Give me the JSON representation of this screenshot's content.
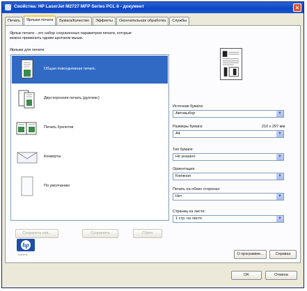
{
  "window": {
    "title": "Свойства: HP LaserJet M2727 MFP Series PCL 6 - документ"
  },
  "tabs": [
    {
      "label": "Печать"
    },
    {
      "label": "Ярлыки печати"
    },
    {
      "label": "Бумага/Качество"
    },
    {
      "label": "Эффекты"
    },
    {
      "label": "Окончательная обработка"
    },
    {
      "label": "Службы"
    }
  ],
  "panel": {
    "description": "Ярлык печати - это набор сохраненных параметров печати, которые можно применить одним щелчком мыши.",
    "list_label": "Ярлыки для печати:"
  },
  "shortcuts": [
    {
      "label": "Общая повседневная печать",
      "icon": "document-icon",
      "selected": true
    },
    {
      "label": "Двусторонняя печать (дуплекс)",
      "icon": "duplex-icon",
      "selected": false
    },
    {
      "label": "Печать буклетов",
      "icon": "booklet-icon",
      "selected": false
    },
    {
      "label": "Конверты",
      "icon": "envelope-icon",
      "selected": false
    },
    {
      "label": "По умолчанию",
      "icon": "blank-page-icon",
      "selected": false
    }
  ],
  "list_buttons": {
    "save_as": "Сохранить как...",
    "save": "Сохранить",
    "reset": "Сброс"
  },
  "settings": {
    "paper_source": {
      "label": "Источник бумаги:",
      "value": "Автовыбор"
    },
    "paper_size": {
      "label": "Размеры бумаги:",
      "size_text": "210 x 297 мм",
      "value": "A4"
    },
    "paper_type": {
      "label": "Тип бумаги:",
      "value": "Не указано"
    },
    "orientation": {
      "label": "Ориентация:",
      "value": "Книжная"
    },
    "duplex": {
      "label": "Печать на обеих сторонах:",
      "value": "Нет"
    },
    "pages_per_sheet": {
      "label": "Страниц на листе:",
      "value": "1 стр. на листе"
    }
  },
  "footer_buttons": {
    "about": "О программе...",
    "help": "Справка",
    "ok": "OK",
    "cancel": "Отмена"
  },
  "brand": {
    "logo_text": "hp",
    "tagline": "invent"
  },
  "colors": {
    "title_bar": "#0d46c4",
    "selection": "#316ac5",
    "active_tab_accent": "#ffc83c"
  }
}
